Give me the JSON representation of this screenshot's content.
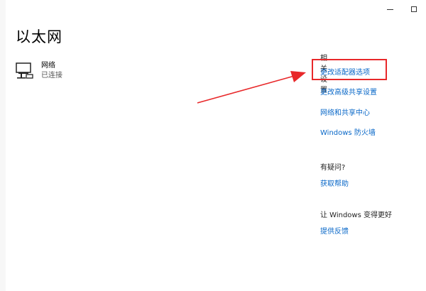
{
  "window": {
    "minimize_label": "–",
    "maximize_label": "□"
  },
  "page_title": "以太网",
  "network": {
    "icon": "ethernet-monitor-icon",
    "name": "网络",
    "status": "已连接"
  },
  "related_settings": {
    "heading": "相关设置",
    "links": [
      "更改适配器选项",
      "更改高级共享设置",
      "网络和共享中心",
      "Windows 防火墙"
    ]
  },
  "help": {
    "heading": "有疑问?",
    "link": "获取帮助"
  },
  "improve": {
    "heading": "让 Windows 变得更好",
    "link": "提供反馈"
  },
  "colors": {
    "link": "#0a68c8",
    "highlight": "#e8282a",
    "arrow": "#e8282a"
  }
}
